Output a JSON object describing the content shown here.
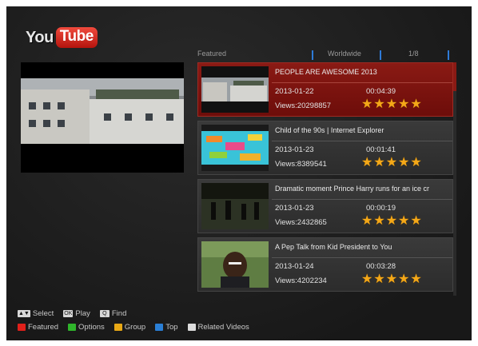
{
  "logo": {
    "you": "You",
    "tube": "Tube"
  },
  "header": {
    "category": "Featured",
    "region": "Worldwide",
    "page": "1/8"
  },
  "videos": [
    {
      "title": "PEOPLE ARE AWESOME 2013",
      "date": "2013-01-22",
      "duration": "00:04:39",
      "views": "Views:20298857",
      "rating": 5,
      "selected": true
    },
    {
      "title": "Child of the 90s | Internet Explorer",
      "date": "2013-01-23",
      "duration": "00:01:41",
      "views": "Views:8389541",
      "rating": 5,
      "selected": false
    },
    {
      "title": "Dramatic moment Prince Harry runs for an ice cr",
      "date": "2013-01-23",
      "duration": "00:00:19",
      "views": "Views:2432865",
      "rating": 5,
      "selected": false
    },
    {
      "title": "A Pep Talk from Kid President to You",
      "date": "2013-01-24",
      "duration": "00:03:28",
      "views": "Views:4202234",
      "rating": 5,
      "selected": false
    }
  ],
  "hints": {
    "row1": [
      {
        "key": "▲▼",
        "label": "Select"
      },
      {
        "key": "OK",
        "label": "Play"
      },
      {
        "key": "Q",
        "label": "Find"
      }
    ],
    "row2": [
      {
        "color": "#e0201a",
        "label": "Featured"
      },
      {
        "color": "#2fb52b",
        "label": "Options"
      },
      {
        "color": "#e8a815",
        "label": "Group"
      },
      {
        "color": "#2a7fd6",
        "label": "Top"
      },
      {
        "color": "#dcdcdc",
        "label": "Related Videos"
      }
    ]
  },
  "colors": {
    "selected_bg": "#7a1410",
    "star": "#f4a818",
    "header_tick": "#2e7bd8"
  },
  "icons": {
    "star": "star-icon"
  }
}
